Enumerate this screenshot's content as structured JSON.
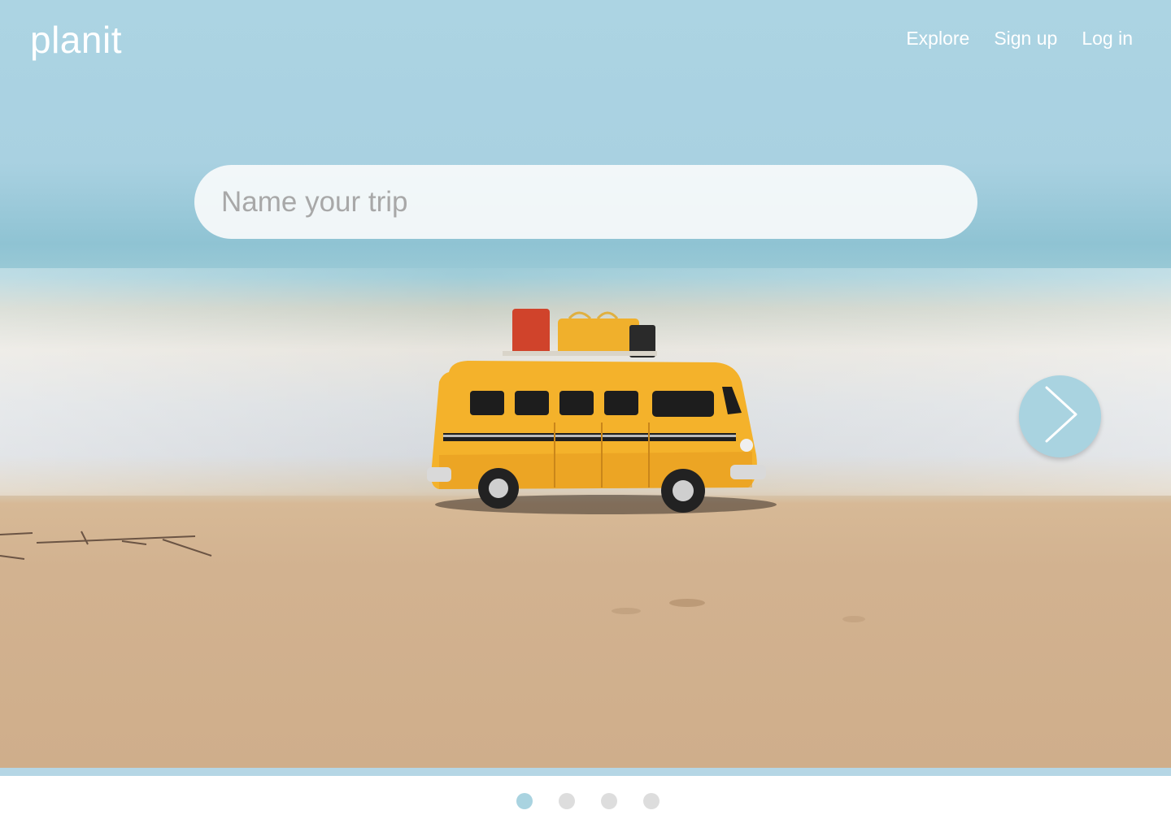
{
  "brand": {
    "name": "planit"
  },
  "nav": {
    "items": [
      {
        "label": "Explore"
      },
      {
        "label": "Sign up"
      },
      {
        "label": "Log in"
      }
    ]
  },
  "search": {
    "placeholder": "Name your trip",
    "value": ""
  },
  "hero": {
    "image_subject": "toy yellow van on a beach",
    "next_icon": "chevron-right-icon"
  },
  "carousel": {
    "total_slides": 4,
    "active_index": 0
  },
  "colors": {
    "accent": "#a9d3e0",
    "strip": "#b5d6e5",
    "inactive_dot": "#dddddd",
    "text_on_hero": "#ffffff"
  }
}
